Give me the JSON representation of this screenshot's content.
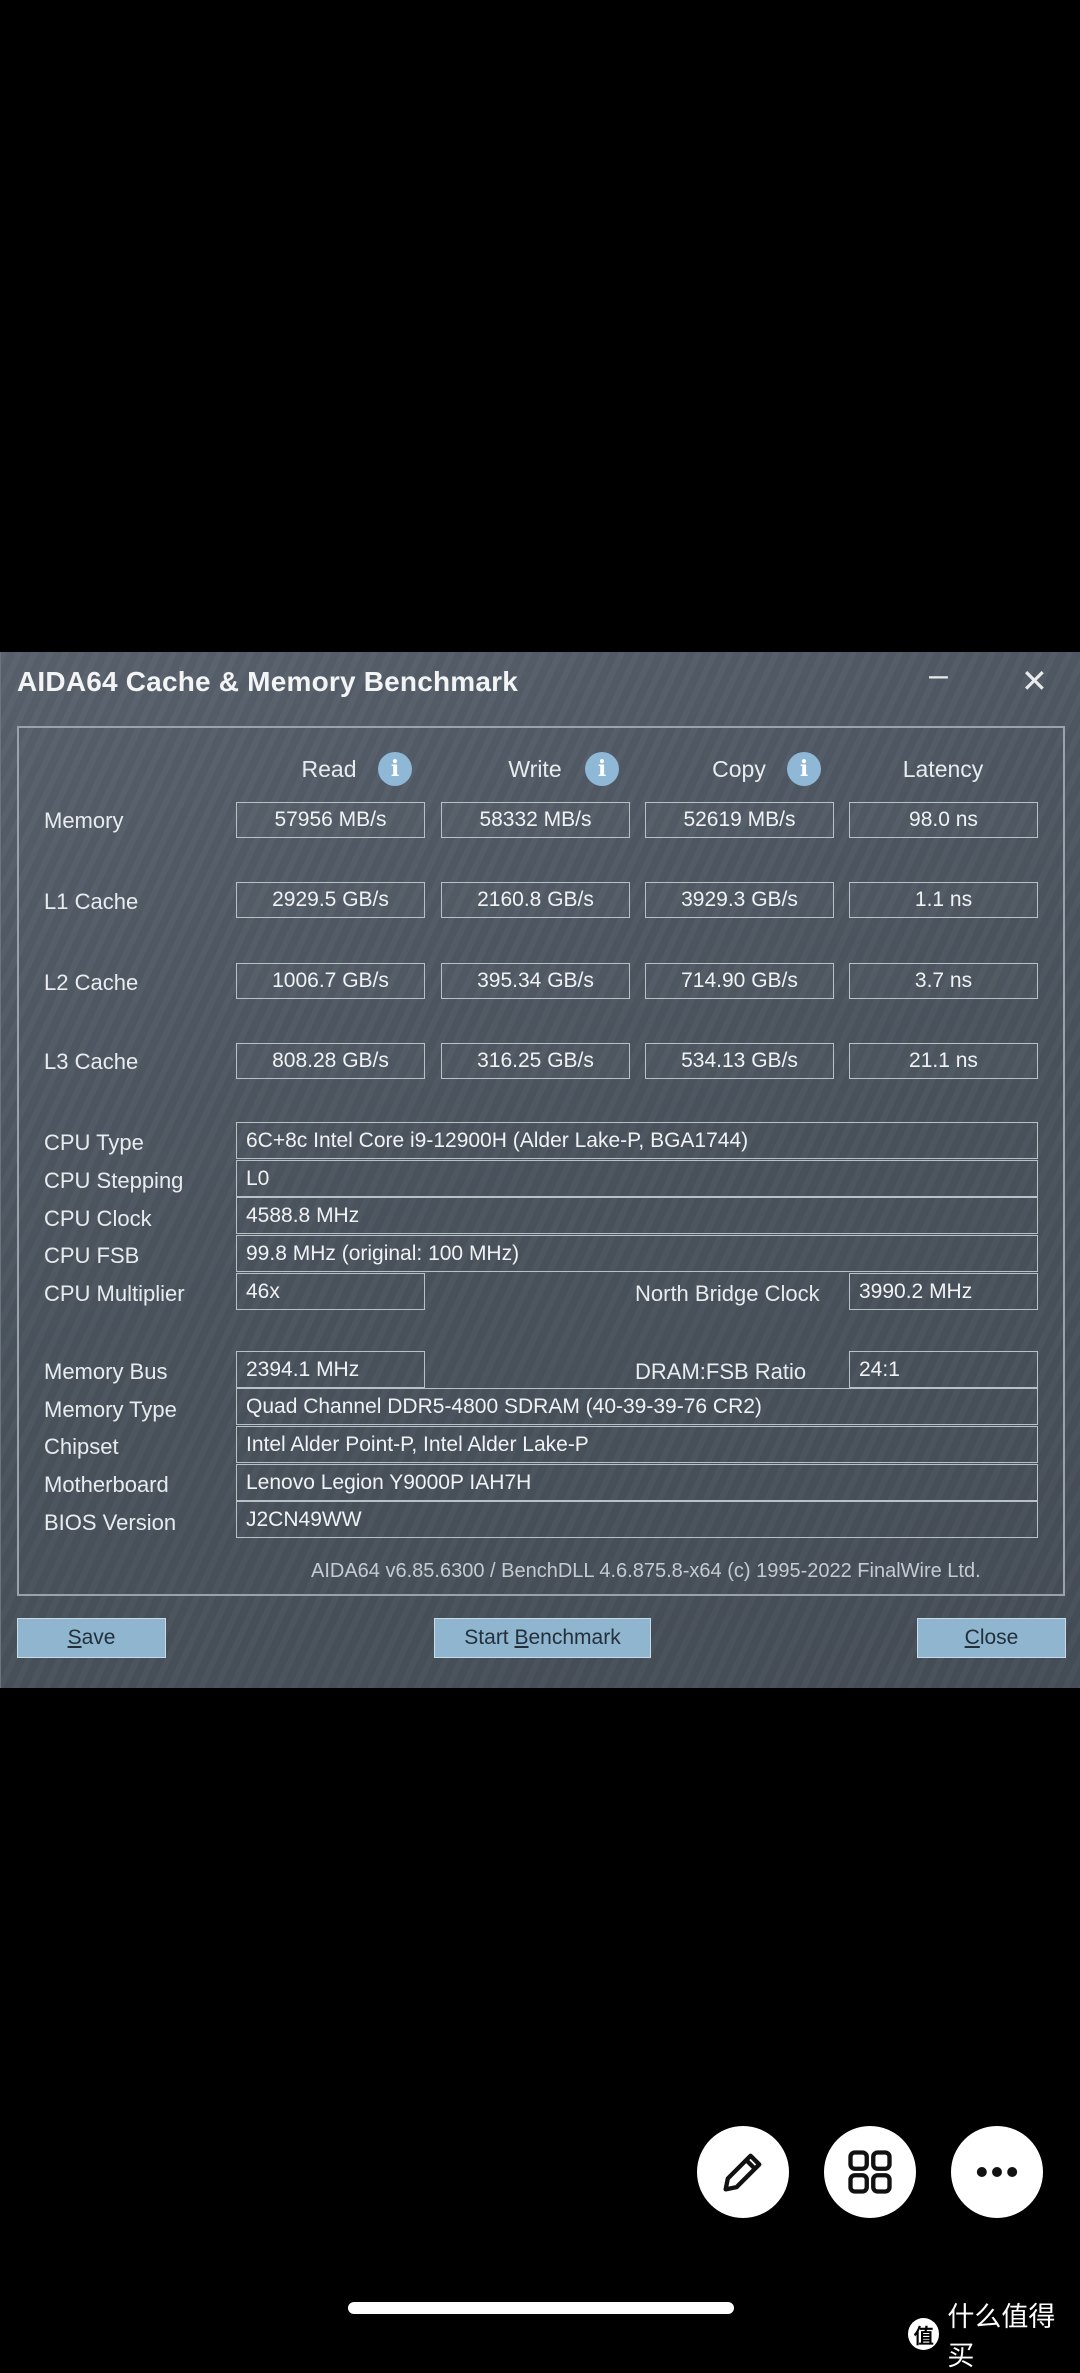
{
  "window": {
    "title": "AIDA64 Cache & Memory Benchmark",
    "minimize_glyph": "–",
    "close_glyph": "✕"
  },
  "columns": {
    "read": "Read",
    "write": "Write",
    "copy": "Copy",
    "latency": "Latency",
    "info_glyph": "i"
  },
  "bench_rows": [
    {
      "label": "Memory",
      "read": "57956 MB/s",
      "write": "58332 MB/s",
      "copy": "52619 MB/s",
      "latency": "98.0 ns"
    },
    {
      "label": "L1 Cache",
      "read": "2929.5 GB/s",
      "write": "2160.8 GB/s",
      "copy": "3929.3 GB/s",
      "latency": "1.1 ns"
    },
    {
      "label": "L2 Cache",
      "read": "1006.7 GB/s",
      "write": "395.34 GB/s",
      "copy": "714.90 GB/s",
      "latency": "3.7 ns"
    },
    {
      "label": "L3 Cache",
      "read": "808.28 GB/s",
      "write": "316.25 GB/s",
      "copy": "534.13 GB/s",
      "latency": "21.1 ns"
    }
  ],
  "cpu": {
    "type_label": "CPU Type",
    "type": "6C+8c Intel Core i9-12900H  (Alder Lake-P, BGA1744)",
    "stepping_label": "CPU Stepping",
    "stepping": "L0",
    "clock_label": "CPU Clock",
    "clock": "4588.8 MHz",
    "fsb_label": "CPU FSB",
    "fsb": "99.8 MHz  (original: 100 MHz)",
    "multiplier_label": "CPU Multiplier",
    "multiplier": "46x",
    "nb_clock_label": "North Bridge Clock",
    "nb_clock": "3990.2 MHz"
  },
  "memory": {
    "bus_label": "Memory Bus",
    "bus": "2394.1 MHz",
    "ratio_label": "DRAM:FSB Ratio",
    "ratio": "24:1",
    "type_label": "Memory Type",
    "type": "Quad Channel DDR5-4800 SDRAM  (40-39-39-76 CR2)",
    "chipset_label": "Chipset",
    "chipset": "Intel Alder Point-P, Intel Alder Lake-P",
    "motherboard_label": "Motherboard",
    "motherboard": "Lenovo Legion Y9000P IAH7H",
    "bios_label": "BIOS Version",
    "bios": "J2CN49WW"
  },
  "footer": "AIDA64 v6.85.6300 / BenchDLL 4.6.875.8-x64  (c) 1995-2022 FinalWire Ltd.",
  "buttons": {
    "save_first": "S",
    "save_rest": "ave",
    "start_pre": "Start ",
    "start_mnemonic": "B",
    "start_rest": "enchmark",
    "close_first": "C",
    "close_rest": "lose"
  },
  "overlay": {
    "fab_icons": [
      "pencil-icon",
      "grid-icon",
      "more-icon"
    ],
    "watermark": "什么值得买",
    "watermark_logo": "值"
  }
}
